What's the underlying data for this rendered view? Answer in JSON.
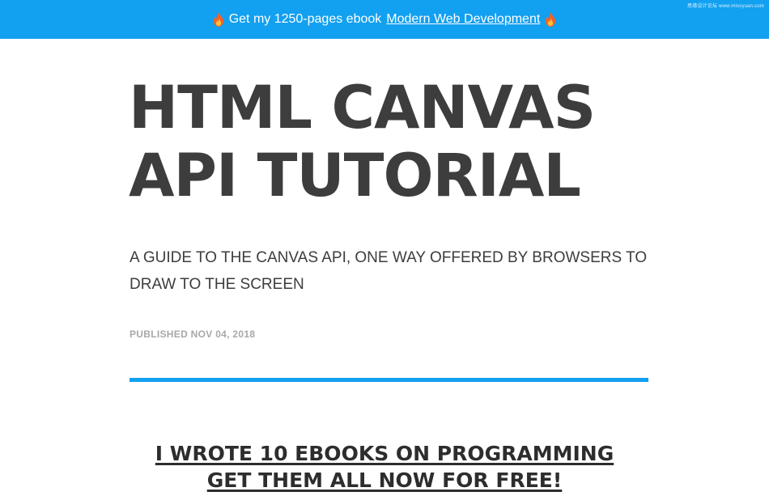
{
  "banner": {
    "prefix": "Get my 1250-pages ebook",
    "link_text": "Modern Web Development",
    "bg_color": "#12a0f0",
    "icon": "fire-icon"
  },
  "watermark": "思缘设计论坛 www.missyuan.com",
  "article": {
    "title_line1": "HTML CANVAS",
    "title_line2": "API TUTORIAL",
    "subtitle": "A GUIDE TO THE CANVAS API, ONE WAY OFFERED BY BROWSERS TO DRAW TO THE SCREEN",
    "published": "PUBLISHED NOV 04, 2018",
    "accent_color": "#12a0f0"
  },
  "promo": {
    "line1": "I WROTE 10 EBOOKS ON PROGRAMMING",
    "line2": "GET THEM ALL NOW FOR FREE!"
  }
}
